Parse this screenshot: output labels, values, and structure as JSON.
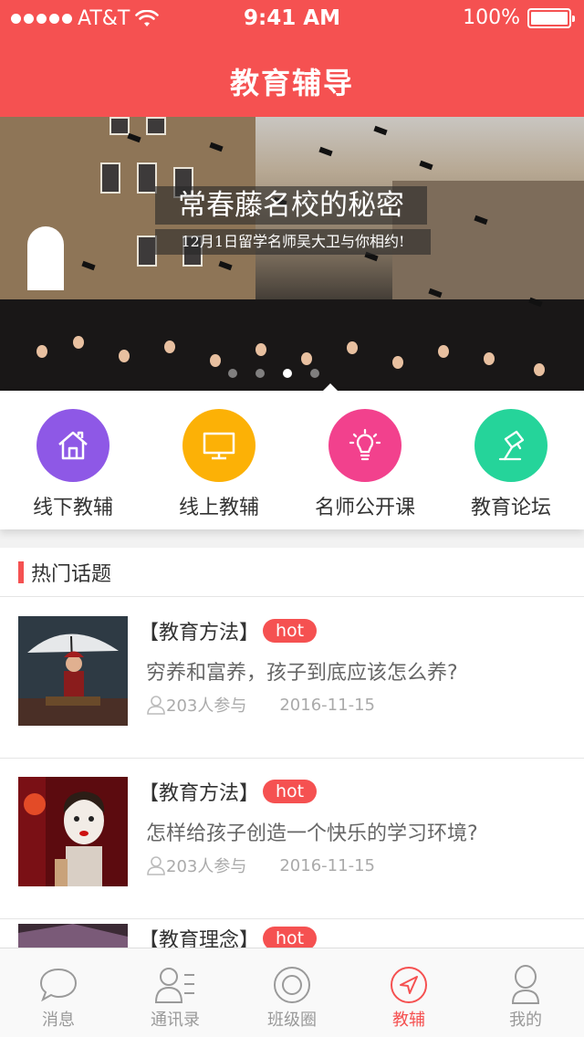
{
  "status_bar": {
    "carrier": "AT&T",
    "time": "9:41 AM",
    "battery": "100%"
  },
  "header": {
    "title": "教育辅导"
  },
  "banner": {
    "title": "常春藤名校的秘密",
    "subtitle": "12月1日留学名师吴大卫与你相约!",
    "pages": 4,
    "active_page": 2
  },
  "categories": [
    {
      "label": "线下教辅",
      "icon": "house-icon",
      "color": "#8e58e6"
    },
    {
      "label": "线上教辅",
      "icon": "monitor-icon",
      "color": "#fcb106"
    },
    {
      "label": "名师公开课",
      "icon": "lightbulb-icon",
      "color": "#f2418d"
    },
    {
      "label": "教育论坛",
      "icon": "desk-lamp-icon",
      "color": "#25d49a"
    }
  ],
  "hot_topics": {
    "title": "热门话题",
    "badge": "hot",
    "items": [
      {
        "tag": "【教育方法】",
        "title": "穷养和富养，孩子到底应该怎么养?",
        "participants": "203人参与",
        "date": "2016-11-15"
      },
      {
        "tag": "【教育方法】",
        "title": "怎样给孩子创造一个快乐的学习环境?",
        "participants": "203人参与",
        "date": "2016-11-15"
      },
      {
        "tag": "【教育理念】",
        "title": "",
        "participants": "",
        "date": ""
      }
    ]
  },
  "tabbar": {
    "active": 3,
    "items": [
      {
        "label": "消息",
        "icon": "chat-bubble-icon"
      },
      {
        "label": "通讯录",
        "icon": "contacts-icon"
      },
      {
        "label": "班级圈",
        "icon": "circle-target-icon"
      },
      {
        "label": "教辅",
        "icon": "navigation-arrow-icon"
      },
      {
        "label": "我的",
        "icon": "person-icon"
      }
    ]
  },
  "colors": {
    "brand": "#f55151",
    "tab_inactive": "#999999"
  }
}
